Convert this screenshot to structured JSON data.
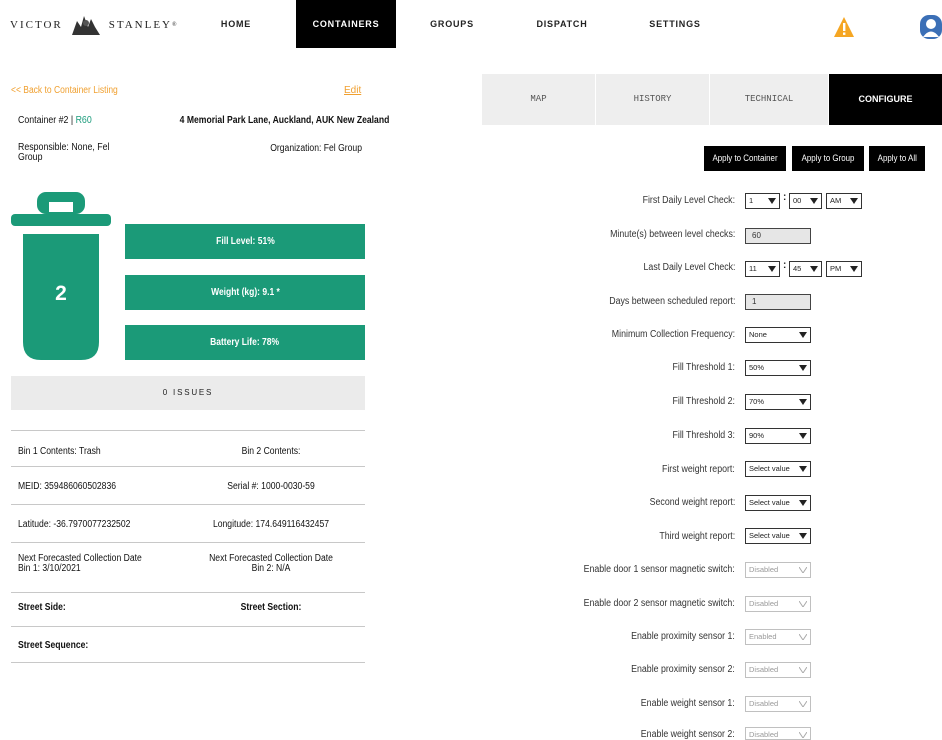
{
  "brand": {
    "left": "VICTOR",
    "right": "STANLEY",
    "mark": "®"
  },
  "nav": {
    "items": [
      {
        "label": "HOME"
      },
      {
        "label": "CONTAINERS"
      },
      {
        "label": "GROUPS"
      },
      {
        "label": "DISPATCH"
      },
      {
        "label": "SETTINGS"
      }
    ]
  },
  "left": {
    "back_link": "<< Back to Container Listing",
    "edit_link": "Edit",
    "container_label": "Container #2 | ",
    "container_rid": "R60",
    "address": "4 Memorial Park Lane, Auckland, AUK New Zealand",
    "responsible": "Responsible: None, Fel Group",
    "organization": "Organization: Fel Group",
    "bin_count": "2",
    "fill_level": "Fill Level: 51%",
    "fill_level_value": 0.51,
    "weight": "Weight (kg): 9.1 *",
    "battery": "Battery Life: 78%",
    "battery_value": 0.78,
    "issues": "0 ISSUES",
    "rows": {
      "bin1_contents": "Bin 1 Contents: Trash",
      "bin2_contents": "Bin 2 Contents:",
      "meid": "MEID: 359486060502836",
      "serial": "Serial #: 1000-0030-59",
      "latitude": "Latitude: -36.7970077232502",
      "longitude": "Longitude: 174.649116432457",
      "next_bin1_l1": "Next Forecasted Collection Date",
      "next_bin1_l2": "Bin 1: 3/10/2021",
      "next_bin2_l1": "Next Forecasted Collection Date",
      "next_bin2_l2": "Bin 2: N/A",
      "street_side": "Street Side:",
      "street_section": "Street Section:",
      "street_sequence": "Street Sequence:"
    }
  },
  "tabs": [
    {
      "label": "MAP"
    },
    {
      "label": "HISTORY"
    },
    {
      "label": "TECHNICAL"
    },
    {
      "label": "CONFIGURE"
    }
  ],
  "apply": {
    "container": "Apply to Container",
    "group": "Apply to Group",
    "all": "Apply to All"
  },
  "config": {
    "first_check_label": "First Daily Level Check:",
    "first_check_hour": "1",
    "first_check_min": "00",
    "first_check_ampm": "AM",
    "minutes_label": "Minute(s) between level checks:",
    "minutes_value": "60",
    "last_check_label": "Last Daily Level Check:",
    "last_check_hour": "11",
    "last_check_min": "45",
    "last_check_ampm": "PM",
    "days_label": "Days between scheduled report:",
    "days_value": "1",
    "min_freq_label": "Minimum Collection Frequency:",
    "min_freq_value": "None",
    "fill1_label": "Fill Threshold 1:",
    "fill1_value": "50%",
    "fill2_label": "Fill Threshold 2:",
    "fill2_value": "70%",
    "fill3_label": "Fill Threshold 3:",
    "fill3_value": "90%",
    "w1_label": "First weight report:",
    "w1_value": "Select value",
    "w2_label": "Second weight report:",
    "w2_value": "Select value",
    "w3_label": "Third weight report:",
    "w3_value": "Select value",
    "door1_label": "Enable door 1 sensor magnetic switch:",
    "door1_value": "Disabled",
    "door2_label": "Enable door 2 sensor magnetic switch:",
    "door2_value": "Disabled",
    "prox1_label": "Enable proximity sensor 1:",
    "prox1_value": "Enabled",
    "prox2_label": "Enable proximity sensor 2:",
    "prox2_value": "Disabled",
    "ws1_label": "Enable weight sensor 1:",
    "ws1_value": "Disabled",
    "ws2_label": "Enable weight sensor 2:",
    "ws2_value": "Disabled"
  },
  "colors": {
    "accent_green": "#1b9a78",
    "link_orange": "#f0a030",
    "warning": "#f5a623",
    "user_icon": "#3b6fb6"
  },
  "icons": {
    "warning": "warning-triangle-icon",
    "user": "user-icon",
    "bin": "trash-bin-icon",
    "chevron": "chevron-down-icon"
  }
}
